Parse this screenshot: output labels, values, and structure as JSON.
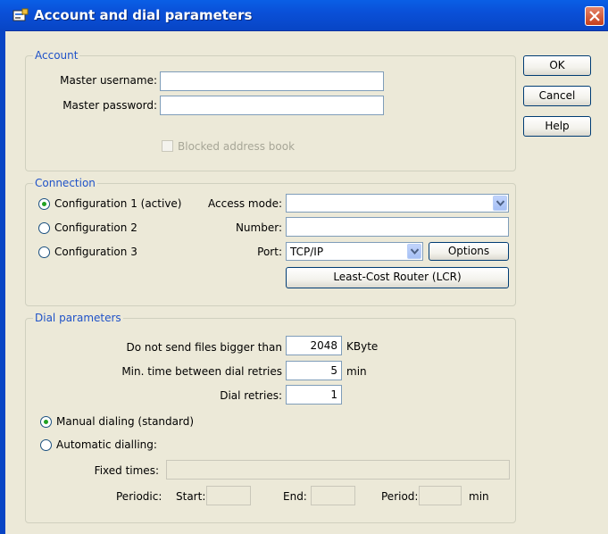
{
  "window": {
    "title": "Account and dial parameters"
  },
  "side_buttons": {
    "ok": "OK",
    "cancel": "Cancel",
    "help": "Help"
  },
  "account": {
    "legend": "Account",
    "username_label": "Master username:",
    "username_value": "",
    "password_label": "Master password:",
    "password_value": "",
    "blocked_label": "Blocked address book"
  },
  "connection": {
    "legend": "Connection",
    "configs": [
      {
        "label": "Configuration 1 (active)",
        "selected": true
      },
      {
        "label": "Configuration 2",
        "selected": false
      },
      {
        "label": "Configuration 3",
        "selected": false
      }
    ],
    "access_mode_label": "Access mode:",
    "access_mode_value": "",
    "number_label": "Number:",
    "number_value": "",
    "port_label": "Port:",
    "port_value": "TCP/IP",
    "options_button": "Options",
    "lcr_button": "Least-Cost Router (LCR)"
  },
  "dial": {
    "legend": "Dial parameters",
    "max_size_label": "Do not send files bigger than",
    "max_size_value": "2048",
    "max_size_unit": "KByte",
    "min_time_label": "Min. time between dial retries",
    "min_time_value": "5",
    "min_time_unit": "min",
    "retries_label": "Dial retries:",
    "retries_value": "1",
    "manual_label": "Manual dialing (standard)",
    "automatic_label": "Automatic dialling:",
    "fixed_times_label": "Fixed times:",
    "periodic_label": "Periodic:",
    "start_label": "Start:",
    "end_label": "End:",
    "period_label": "Period:",
    "period_unit": "min"
  },
  "colors": {
    "titlebar": "#0a50d8",
    "group_legend": "#1f52c8",
    "radio_dot": "#21a121",
    "background": "#ece9d8"
  }
}
